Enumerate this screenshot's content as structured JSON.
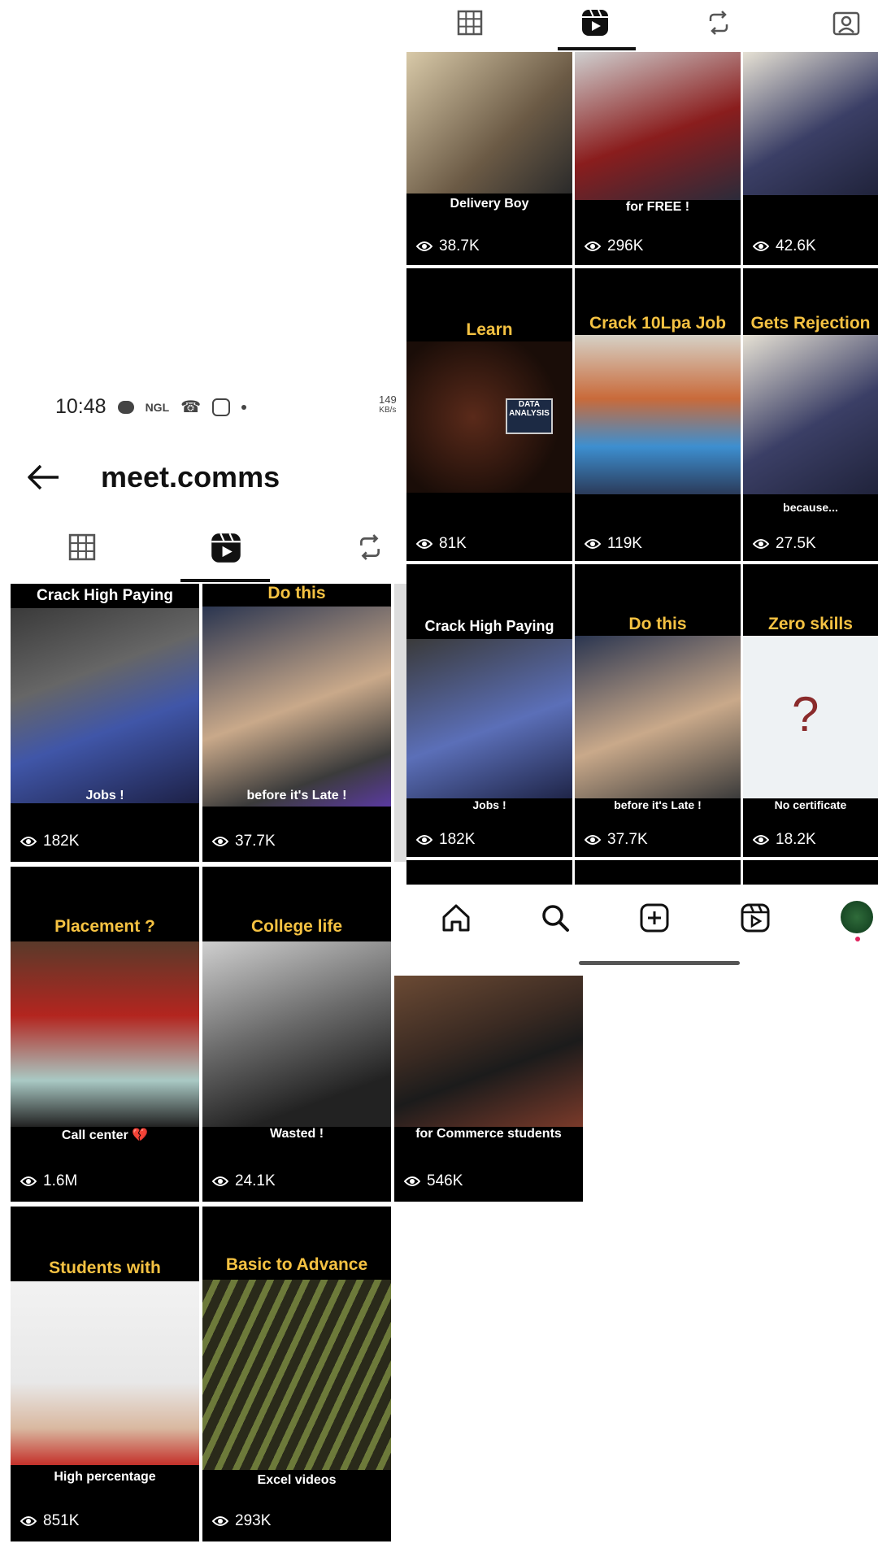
{
  "status_bar": {
    "time": "10:48",
    "ngl": "NGL",
    "network_value": "149",
    "network_unit": "KB/s"
  },
  "header": {
    "title": "meet.comms"
  },
  "left_grid": [
    {
      "top": "Crack High Paying",
      "bottom": "Jobs !",
      "views": "182K",
      "top_color": "white"
    },
    {
      "top": "Do this",
      "bottom": "before it's Late !",
      "views": "37.7K",
      "top_color": "yellow"
    },
    {
      "top": "Placement ?",
      "bottom": "Call center 💔",
      "views": "1.6M",
      "top_color": "yellow"
    },
    {
      "top": "College life",
      "bottom": "Wasted !",
      "views": "24.1K",
      "top_color": "yellow"
    },
    {
      "top": "",
      "bottom": "for Commerce students",
      "views": "546K",
      "top_color": "yellow"
    },
    {
      "top": "Students with",
      "bottom": "High percentage",
      "views": "851K",
      "top_color": "yellow"
    },
    {
      "top": "Basic to Advance",
      "bottom": "Excel videos",
      "views": "293K",
      "top_color": "yellow"
    }
  ],
  "right_grid": [
    {
      "top": "",
      "bottom": "Delivery Boy",
      "views": "38.7K",
      "top_color": "white"
    },
    {
      "top": "",
      "bottom": "for FREE !",
      "views": "296K",
      "top_color": "white"
    },
    {
      "top": "",
      "bottom": "",
      "views": "42.6K",
      "top_color": "white"
    },
    {
      "top": "Learn",
      "bottom": "",
      "views": "81K",
      "top_color": "yellow",
      "overlay": "DATA ANALYSIS"
    },
    {
      "top": "Crack 10Lpa Job",
      "bottom": "",
      "views": "119K",
      "top_color": "yellow"
    },
    {
      "top": "Gets Rejection",
      "bottom": "because...",
      "views": "27.5K",
      "top_color": "yellow"
    },
    {
      "top": "Crack High Paying",
      "bottom": "Jobs !",
      "views": "182K",
      "top_color": "white"
    },
    {
      "top": "Do this",
      "bottom": "before it's Late !",
      "views": "37.7K",
      "top_color": "yellow"
    },
    {
      "top": "Zero skills",
      "bottom": "No certificate",
      "views": "18.2K",
      "top_color": "yellow"
    }
  ],
  "colors": {
    "yellow": "#f5c242",
    "tile_bg": "#000000",
    "accent_dot": "#e0245e"
  }
}
